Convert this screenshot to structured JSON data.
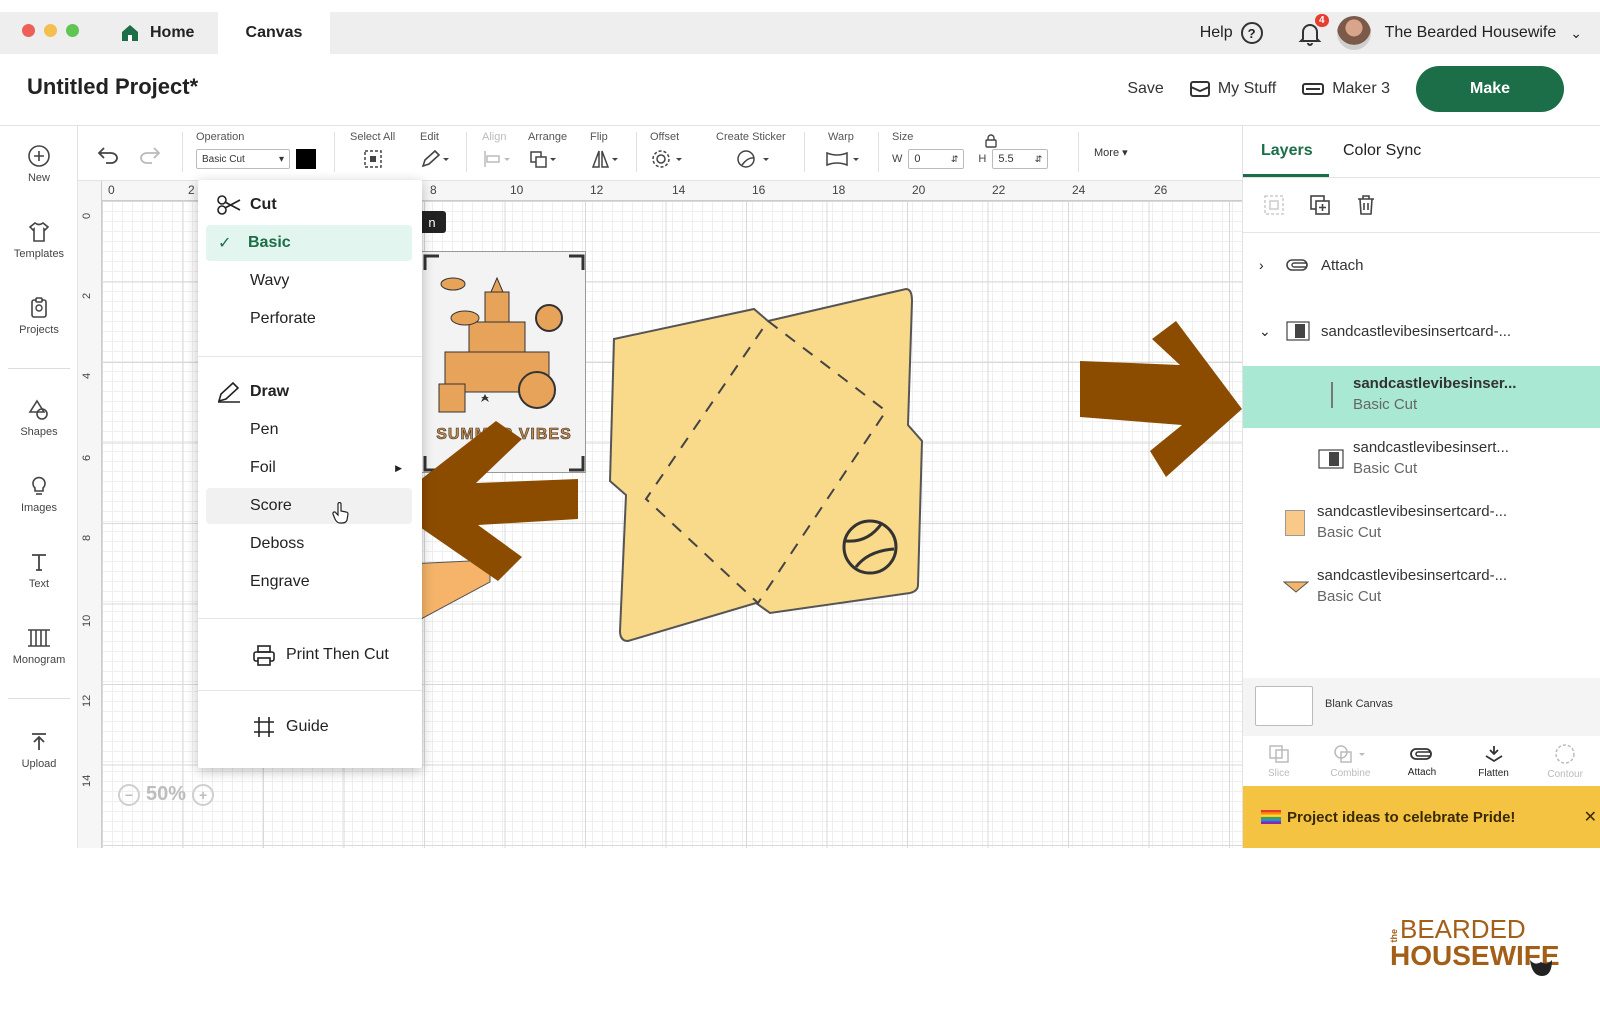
{
  "window": {
    "tabs": [
      {
        "label": "Home"
      },
      {
        "label": "Canvas"
      }
    ],
    "help_label": "Help",
    "notifications_count": "4",
    "user_name": "The Bearded Housewife"
  },
  "header": {
    "project_title": "Untitled Project*",
    "save_label": "Save",
    "my_stuff_label": "My Stuff",
    "machine_label": "Maker 3",
    "make_label": "Make"
  },
  "sidebar": {
    "items": [
      {
        "label": "New",
        "icon": "plus-circle-icon"
      },
      {
        "label": "Templates",
        "icon": "shirt-icon"
      },
      {
        "label": "Projects",
        "icon": "clipboard-icon"
      },
      {
        "label": "Shapes",
        "icon": "shapes-icon"
      },
      {
        "label": "Images",
        "icon": "bulb-icon"
      },
      {
        "label": "Text",
        "icon": "text-icon"
      },
      {
        "label": "Monogram",
        "icon": "monogram-icon"
      },
      {
        "label": "Upload",
        "icon": "upload-icon"
      }
    ]
  },
  "toolbar": {
    "operation_label": "Operation",
    "operation_value": "Basic Cut",
    "select_all_label": "Select All",
    "edit_label": "Edit",
    "align_label": "Align",
    "arrange_label": "Arrange",
    "flip_label": "Flip",
    "offset_label": "Offset",
    "create_sticker_label": "Create Sticker",
    "warp_label": "Warp",
    "size_label": "Size",
    "w_label": "W",
    "w_value": "0",
    "h_label": "H",
    "h_value": "5.5",
    "more_label": "More"
  },
  "canvas": {
    "ruler_top": [
      "0",
      "2",
      "8",
      "10",
      "12",
      "14",
      "16",
      "18",
      "20",
      "22",
      "24",
      "26"
    ],
    "ruler_left": [
      "0",
      "2",
      "4",
      "6",
      "8",
      "10",
      "12",
      "14"
    ],
    "zoom_value": "50%",
    "tooltip_fragment": "n",
    "card_text": "SUMMER VIBES"
  },
  "operation_menu": {
    "cut_header": "Cut",
    "cut_items": [
      "Basic",
      "Wavy",
      "Perforate"
    ],
    "selected": "Basic",
    "draw_header": "Draw",
    "draw_items": [
      "Pen",
      "Foil",
      "Score",
      "Deboss",
      "Engrave"
    ],
    "print_then_cut": "Print Then Cut",
    "guide": "Guide"
  },
  "layers_panel": {
    "tabs": [
      "Layers",
      "Color Sync"
    ],
    "attach_label": "Attach",
    "group_name": "sandcastlevibesinsertcard-...",
    "layers": [
      {
        "name": "sandcastlevibesinser...",
        "op": "Basic Cut"
      },
      {
        "name": "sandcastlevibesinsert...",
        "op": "Basic Cut"
      },
      {
        "name": "sandcastlevibesinsertcard-...",
        "op": "Basic Cut"
      },
      {
        "name": "sandcastlevibesinsertcard-...",
        "op": "Basic Cut"
      }
    ],
    "blank_canvas_label": "Blank Canvas",
    "actions": [
      "Slice",
      "Combine",
      "Attach",
      "Flatten",
      "Contour"
    ],
    "promo_text": "Project ideas to celebrate Pride!"
  },
  "watermark": {
    "line1": "BEARDED",
    "line2": "HOUSEWIFE",
    "small": "the"
  },
  "colors": {
    "accent": "#1c6e48",
    "selected_layer": "#a9e8d2",
    "envelope": "#f9d98a",
    "arrow": "#8b4c00",
    "promo": "#f5c342"
  }
}
